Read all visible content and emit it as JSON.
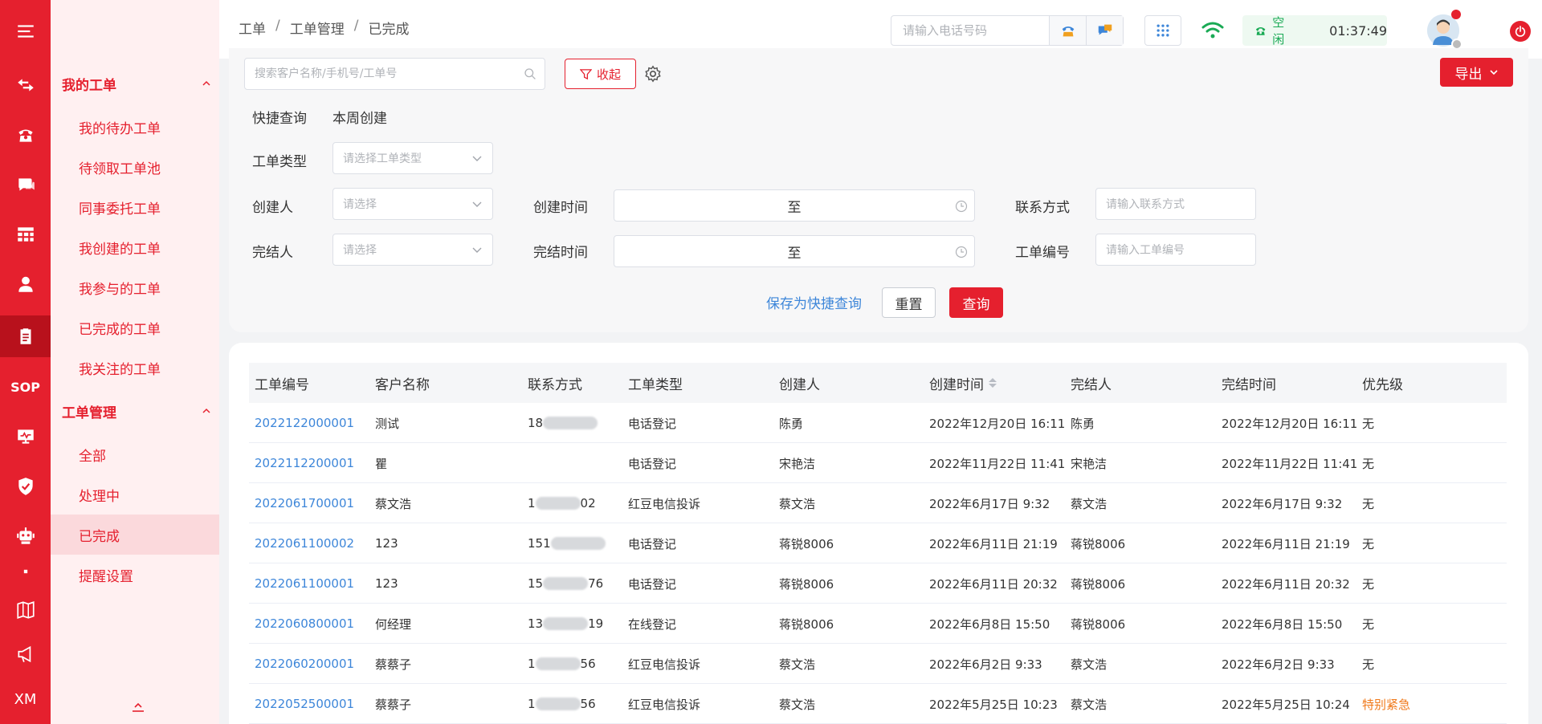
{
  "rail": {
    "items": [
      {
        "icon": "menu-icon"
      },
      {
        "icon": "transfer-icon"
      },
      {
        "icon": "phone-icon"
      },
      {
        "icon": "chat-icon"
      },
      {
        "icon": "table-icon"
      },
      {
        "icon": "user-icon"
      },
      {
        "icon": "clipboard-icon"
      },
      {
        "label": "SOP"
      },
      {
        "icon": "monitor-icon"
      },
      {
        "icon": "shield-icon"
      },
      {
        "icon": "robot-icon"
      },
      {
        "icon": "dot-icon"
      },
      {
        "icon": "book-icon"
      },
      {
        "icon": "megaphone-icon"
      },
      {
        "label": "XM"
      }
    ]
  },
  "menu": {
    "group1": "我的工单",
    "group1_items": [
      "我的待办工单",
      "待领取工单池",
      "同事委托工单",
      "我创建的工单",
      "我参与的工单",
      "已完成的工单",
      "我关注的工单"
    ],
    "group2": "工单管理",
    "group2_items": [
      "全部",
      "处理中",
      "已完成",
      "提醒设置"
    ]
  },
  "breadcrumb": {
    "l1": "工单",
    "l2": "工单管理",
    "l3": "已完成",
    "sep": "/"
  },
  "header": {
    "phone_placeholder": "请输入电话号码",
    "status": "空闲",
    "timer": "01:37:49"
  },
  "toolbar": {
    "search_placeholder": "搜索客户名称/手机号/工单号",
    "collapse_label": "收起",
    "export_label": "导出"
  },
  "filters": {
    "quick_label": "快捷查询",
    "quick_value": "本周创建",
    "type_label": "工单类型",
    "type_placeholder": "请选择工单类型",
    "creator_label": "创建人",
    "creator_placeholder": "请选择",
    "finisher_label": "完结人",
    "finisher_placeholder": "请选择",
    "create_time_label": "创建时间",
    "finish_time_label": "完结时间",
    "range_sep": "至",
    "contact_label": "联系方式",
    "contact_placeholder": "请输入联系方式",
    "no_label": "工单编号",
    "no_placeholder": "请输入工单编号",
    "save_quick": "保存为快捷查询",
    "reset": "重置",
    "query": "查询"
  },
  "table": {
    "columns": [
      "工单编号",
      "客户名称",
      "联系方式",
      "工单类型",
      "创建人",
      "创建时间",
      "完结人",
      "完结时间",
      "优先级"
    ],
    "rows": [
      {
        "id": "2022122000001",
        "customer": "测试",
        "contact_prefix": "18",
        "contact_suffix": "",
        "type": "电话登记",
        "creator": "陈勇",
        "created": "2022年12月20日 16:11",
        "finisher": "陈勇",
        "finished": "2022年12月20日 16:11",
        "priority": "无",
        "urgent": false
      },
      {
        "id": "2022112200001",
        "customer": "瞿",
        "contact_prefix": "",
        "contact_suffix": "",
        "type": "电话登记",
        "creator": "宋艳洁",
        "created": "2022年11月22日 11:41",
        "finisher": "宋艳洁",
        "finished": "2022年11月22日 11:41",
        "priority": "无",
        "urgent": false
      },
      {
        "id": "2022061700001",
        "customer": "蔡文浩",
        "contact_prefix": "1",
        "contact_suffix": "02",
        "type": "红豆电信投诉",
        "creator": "蔡文浩",
        "created": "2022年6月17日 9:32",
        "finisher": "蔡文浩",
        "finished": "2022年6月17日 9:32",
        "priority": "无",
        "urgent": false
      },
      {
        "id": "2022061100002",
        "customer": "123",
        "contact_prefix": "151",
        "contact_suffix": "",
        "type": "电话登记",
        "creator": "蒋锐8006",
        "created": "2022年6月11日 21:19",
        "finisher": "蒋锐8006",
        "finished": "2022年6月11日 21:19",
        "priority": "无",
        "urgent": false
      },
      {
        "id": "2022061100001",
        "customer": "123",
        "contact_prefix": "15",
        "contact_suffix": "76",
        "type": "电话登记",
        "creator": "蒋锐8006",
        "created": "2022年6月11日 20:32",
        "finisher": "蒋锐8006",
        "finished": "2022年6月11日 20:32",
        "priority": "无",
        "urgent": false
      },
      {
        "id": "2022060800001",
        "customer": "何经理",
        "contact_prefix": "13",
        "contact_suffix": "19",
        "type": "在线登记",
        "creator": "蒋锐8006",
        "created": "2022年6月8日 15:50",
        "finisher": "蒋锐8006",
        "finished": "2022年6月8日 15:50",
        "priority": "无",
        "urgent": false
      },
      {
        "id": "2022060200001",
        "customer": "蔡蔡子",
        "contact_prefix": "1",
        "contact_suffix": "56",
        "type": "红豆电信投诉",
        "creator": "蔡文浩",
        "created": "2022年6月2日 9:33",
        "finisher": "蔡文浩",
        "finished": "2022年6月2日 9:33",
        "priority": "无",
        "urgent": false
      },
      {
        "id": "2022052500001",
        "customer": "蔡蔡子",
        "contact_prefix": "1",
        "contact_suffix": "56",
        "type": "红豆电信投诉",
        "creator": "蔡文浩",
        "created": "2022年5月25日 10:23",
        "finisher": "蔡文浩",
        "finished": "2022年5月25日 10:24",
        "priority": "特别紧急",
        "urgent": true
      }
    ]
  },
  "colors": {
    "brand": "#e5202e",
    "menu_bg": "#fff0f1",
    "link": "#3d86d9",
    "status_green": "#1aaa55",
    "urgent": "#f07a1c"
  }
}
